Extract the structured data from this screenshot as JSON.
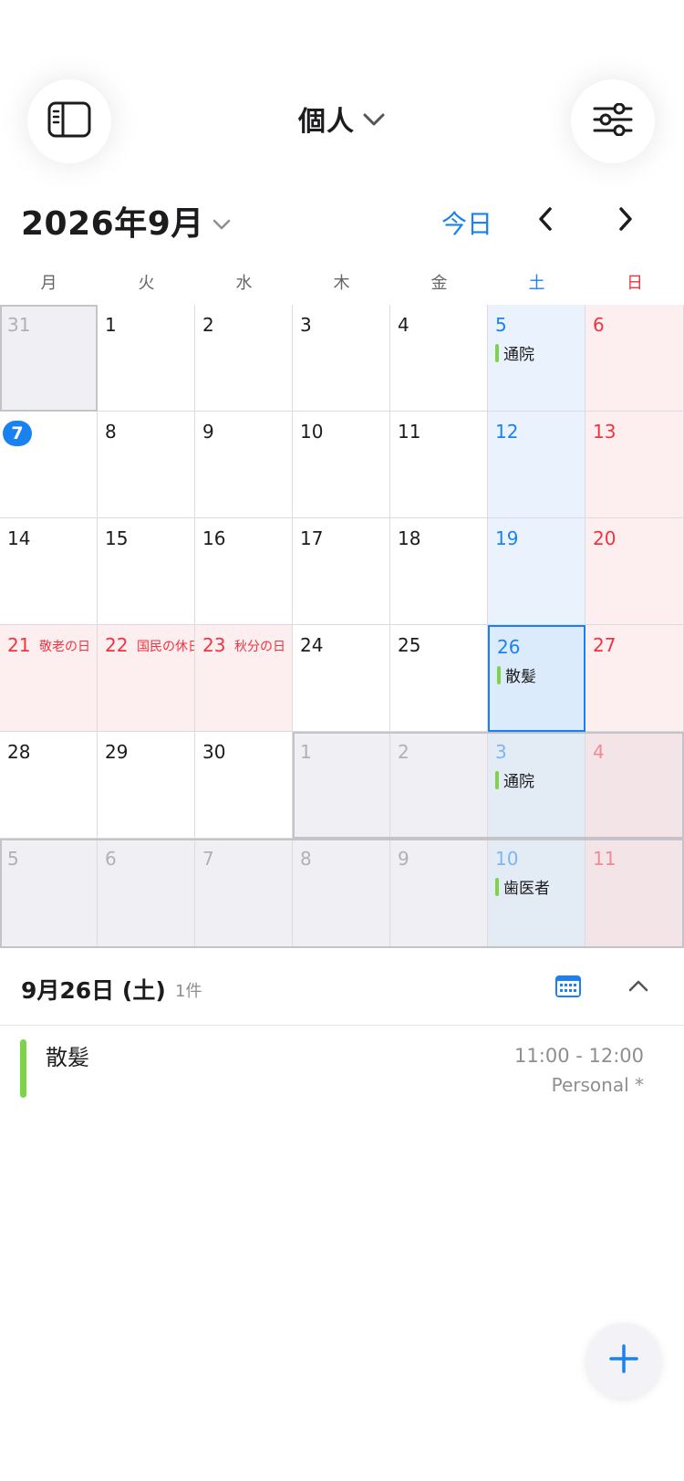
{
  "header": {
    "calendar_name": "個人",
    "icons": {
      "sidebar": "sidebar-icon",
      "filter": "sliders-icon",
      "dropdown": "chevron-down-icon"
    }
  },
  "month_nav": {
    "month_label": "2026年9月",
    "today_label": "今日",
    "prev": "chevron-left-icon",
    "next": "chevron-right-icon"
  },
  "weekdays": [
    "月",
    "火",
    "水",
    "木",
    "金",
    "土",
    "日"
  ],
  "weeks": [
    [
      {
        "day": "31",
        "state": "other"
      },
      {
        "day": "1"
      },
      {
        "day": "2"
      },
      {
        "day": "3"
      },
      {
        "day": "4"
      },
      {
        "day": "5",
        "events": [
          "通院"
        ]
      },
      {
        "day": "6"
      }
    ],
    [
      {
        "day": "7",
        "today": true
      },
      {
        "day": "8"
      },
      {
        "day": "9"
      },
      {
        "day": "10"
      },
      {
        "day": "11"
      },
      {
        "day": "12"
      },
      {
        "day": "13"
      }
    ],
    [
      {
        "day": "14"
      },
      {
        "day": "15"
      },
      {
        "day": "16"
      },
      {
        "day": "17"
      },
      {
        "day": "18"
      },
      {
        "day": "19"
      },
      {
        "day": "20"
      }
    ],
    [
      {
        "day": "21",
        "holiday": "敬老の日"
      },
      {
        "day": "22",
        "holiday": "国民の休日"
      },
      {
        "day": "23",
        "holiday": "秋分の日"
      },
      {
        "day": "24"
      },
      {
        "day": "25"
      },
      {
        "day": "26",
        "selected": true,
        "events": [
          "散髪"
        ]
      },
      {
        "day": "27"
      }
    ],
    [
      {
        "day": "28"
      },
      {
        "day": "29"
      },
      {
        "day": "30"
      },
      {
        "day": "1",
        "state": "other"
      },
      {
        "day": "2",
        "state": "other"
      },
      {
        "day": "3",
        "state": "other",
        "events": [
          "通院"
        ]
      },
      {
        "day": "4",
        "state": "other"
      }
    ],
    [
      {
        "day": "5",
        "state": "other"
      },
      {
        "day": "6",
        "state": "other"
      },
      {
        "day": "7",
        "state": "other"
      },
      {
        "day": "8",
        "state": "other"
      },
      {
        "day": "9",
        "state": "other"
      },
      {
        "day": "10",
        "state": "other",
        "events": [
          "歯医者"
        ]
      },
      {
        "day": "11",
        "state": "other"
      }
    ]
  ],
  "selected_day": {
    "date_label": "9月26日 (土)",
    "count_label": "1件",
    "calendar_icon": "calendar-icon",
    "collapse_icon": "chevron-up-icon"
  },
  "event_list": [
    {
      "title": "散髪",
      "time": "11:00 - 12:00",
      "calendar": "Personal *",
      "color": "#7ed348"
    }
  ],
  "fab": {
    "icon": "plus-icon"
  },
  "colors": {
    "accent": "#1a82f0",
    "saturday_text": "#1a82f0",
    "sunday_text": "#ef3340",
    "event": "#7ed348",
    "saturday_bg": "#eaf3fd",
    "sunday_bg": "#fdeff0",
    "other_month_bg": "#f0f0f4"
  }
}
